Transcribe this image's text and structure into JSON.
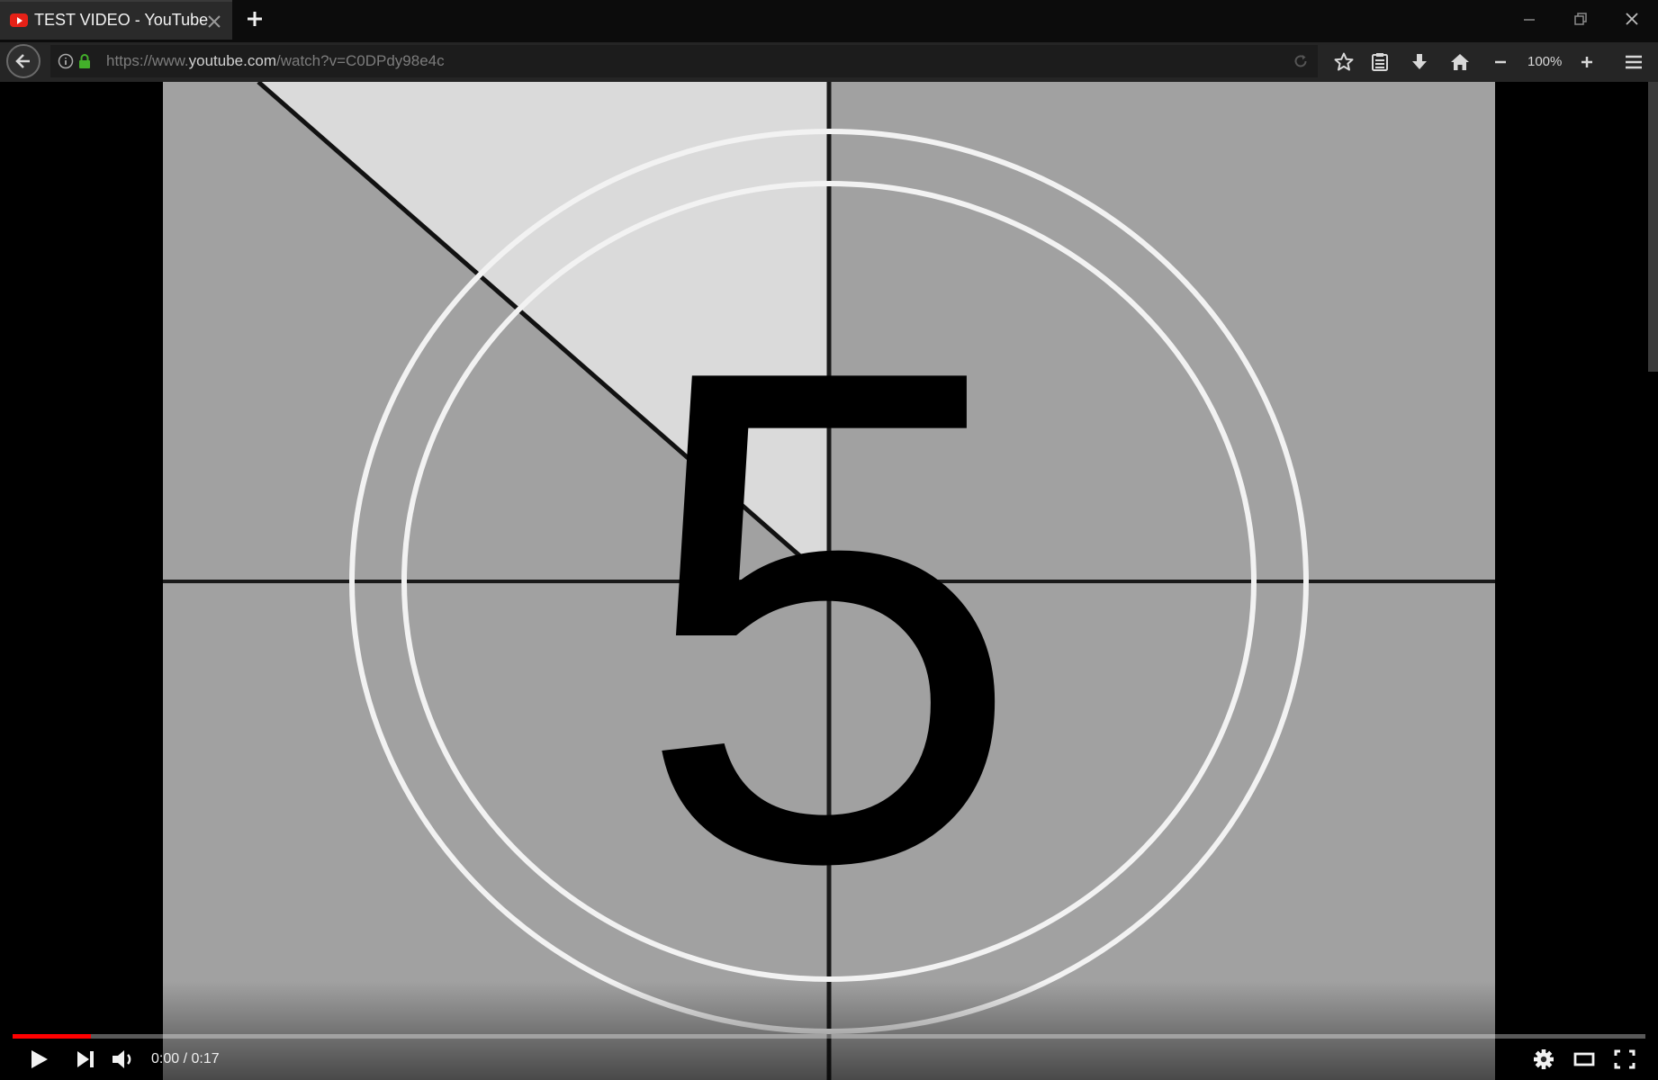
{
  "browser": {
    "tab": {
      "title": "TEST VIDEO - YouTube"
    },
    "url": {
      "scheme": "https://www.",
      "host": "youtube.com",
      "path": "/watch?v=C0DPdy98e4c"
    },
    "zoom": "100%"
  },
  "player": {
    "countdown_digit": "5",
    "time_text": "0:00 / 0:17",
    "progress_fraction": 0.048,
    "accent_color": "#ff0000"
  }
}
